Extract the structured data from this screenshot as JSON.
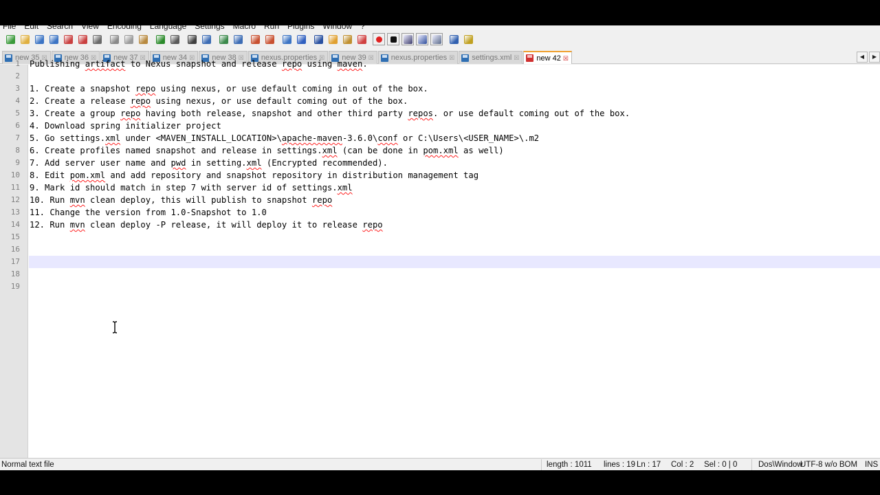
{
  "menu": [
    "File",
    "Edit",
    "Search",
    "View",
    "Encoding",
    "Language",
    "Settings",
    "Macro",
    "Run",
    "Plugins",
    "Window",
    "?"
  ],
  "toolbar_icons": [
    "new-file-icon",
    "open-file-icon",
    "save-icon",
    "save-all-icon",
    "close-icon",
    "close-all-icon",
    "print-icon",
    "cut-icon",
    "copy-icon",
    "paste-icon",
    "undo-icon",
    "redo-icon",
    "find-icon",
    "replace-icon",
    "zoom-in-icon",
    "zoom-out-icon",
    "sync-vertical-icon",
    "sync-horizontal-icon",
    "word-wrap-icon",
    "show-all-chars-icon",
    "indent-guide-icon",
    "folder-as-workspace-icon",
    "doc-map-icon",
    "function-list-icon",
    "record-macro-icon",
    "stop-macro-icon",
    "play-macro-icon",
    "run-macro-multiple-icon",
    "save-macro-icon",
    "spell-check-icon",
    "plugin-icon"
  ],
  "tabs": [
    {
      "label": "new 35",
      "active": false
    },
    {
      "label": "new 36",
      "active": false
    },
    {
      "label": "new 37",
      "active": false
    },
    {
      "label": "new 34",
      "active": false
    },
    {
      "label": "new 38",
      "active": false
    },
    {
      "label": "nexus.properties",
      "active": false
    },
    {
      "label": "new 39",
      "active": false
    },
    {
      "label": "nexus.properties",
      "active": false
    },
    {
      "label": "settings.xml",
      "active": false
    },
    {
      "label": "new 42",
      "active": true
    }
  ],
  "editor": {
    "line_numbers": [
      "1",
      "2",
      "3",
      "4",
      "5",
      "6",
      "7",
      "8",
      "9",
      "10",
      "11",
      "12",
      "13",
      "14",
      "15",
      "16",
      "17",
      "18",
      "19"
    ],
    "lines": [
      [
        {
          "t": "Publishing "
        },
        {
          "t": "artifact",
          "sq": true
        },
        {
          "t": " to Nexus snapshot and release "
        },
        {
          "t": "repo",
          "sq": true
        },
        {
          "t": " using "
        },
        {
          "t": "maven",
          "sq": true
        },
        {
          "t": "."
        }
      ],
      [],
      [
        {
          "t": "1. Create a snapshot "
        },
        {
          "t": "repo",
          "sq": true
        },
        {
          "t": " using nexus, or use default coming in out of the box."
        }
      ],
      [
        {
          "t": "2. Create a release "
        },
        {
          "t": "repo",
          "sq": true
        },
        {
          "t": " using nexus, or use default coming out of the box."
        }
      ],
      [
        {
          "t": "3. Create a group "
        },
        {
          "t": "repo",
          "sq": true
        },
        {
          "t": " having both release, snapshot and other third party "
        },
        {
          "t": "repos",
          "sq": true
        },
        {
          "t": ". or use default coming out of the box."
        }
      ],
      [
        {
          "t": "4. Download spring initializer project"
        }
      ],
      [
        {
          "t": "5. Go settings."
        },
        {
          "t": "xml",
          "sq": true
        },
        {
          "t": " under <MAVEN_INSTALL_LOCATION>\\"
        },
        {
          "t": "apache-maven",
          "sq": true
        },
        {
          "t": "-3.6.0\\"
        },
        {
          "t": "conf",
          "sq": true
        },
        {
          "t": " or C:\\Users\\<USER_NAME>\\.m2"
        }
      ],
      [
        {
          "t": "6. Create profiles named snapshot and release in settings."
        },
        {
          "t": "xml",
          "sq": true
        },
        {
          "t": " (can be done in "
        },
        {
          "t": "pom.xml",
          "sq": true
        },
        {
          "t": " as well)"
        }
      ],
      [
        {
          "t": "7. Add server user name and "
        },
        {
          "t": "pwd",
          "sq": true
        },
        {
          "t": " in setting."
        },
        {
          "t": "xml",
          "sq": true
        },
        {
          "t": " (Encrypted recommended)."
        }
      ],
      [
        {
          "t": "8. Edit "
        },
        {
          "t": "pom.xml",
          "sq": true
        },
        {
          "t": " and add repository and snapshot repository in distribution management tag"
        }
      ],
      [
        {
          "t": "9. Mark id should match in step 7 with server id of settings."
        },
        {
          "t": "xml",
          "sq": true
        }
      ],
      [
        {
          "t": "10. Run "
        },
        {
          "t": "mvn",
          "sq": true
        },
        {
          "t": " clean deploy, this will publish to snapshot "
        },
        {
          "t": "repo",
          "sq": true
        }
      ],
      [
        {
          "t": "11. Change the version from 1.0-Snapshot to 1.0"
        }
      ],
      [
        {
          "t": "12. Run "
        },
        {
          "t": "mvn",
          "sq": true
        },
        {
          "t": " clean deploy -P release, it will deploy it to release "
        },
        {
          "t": "repo",
          "sq": true
        }
      ],
      [],
      [],
      [],
      [],
      []
    ],
    "current_line": 17
  },
  "status": {
    "file_type": "Normal text file",
    "length": "length : 1011",
    "lines": "lines : 19",
    "ln": "Ln : 17",
    "col": "Col : 2",
    "sel": "Sel : 0 | 0",
    "eol": "Dos\\Window",
    "encoding": "UTF-8 w/o BOM",
    "mode": "INS"
  },
  "colors": {
    "current_line_bg": "#e8e8ff",
    "gutter_bg": "#e4e4e4",
    "squiggle": "#ff2020",
    "active_tab_accent": "#f0a030"
  }
}
